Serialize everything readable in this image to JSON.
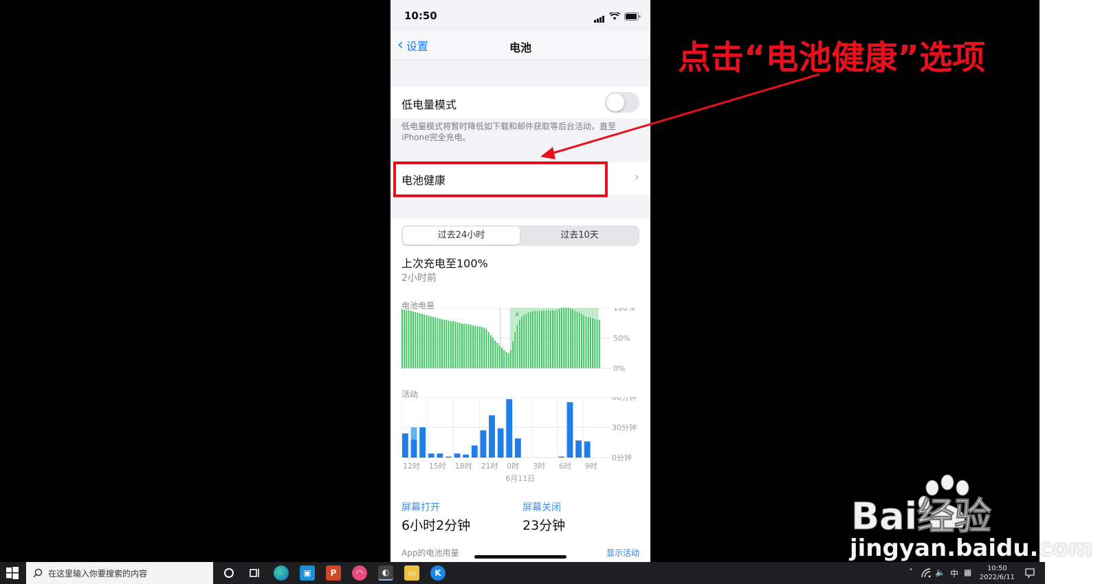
{
  "status_bar": {
    "time": "10:50"
  },
  "nav": {
    "back_label": "设置",
    "title": "电池"
  },
  "low_power": {
    "label": "低电量模式",
    "enabled": false,
    "footnote": "低电量模式将暂时降低如下载和邮件获取等后台活动，直至iPhone完全充电。"
  },
  "battery_health": {
    "label": "电池健康"
  },
  "segment": {
    "options": [
      "过去24小时",
      "过去10天"
    ],
    "selected": 0
  },
  "last_charge": {
    "title": "上次充电至100%",
    "subtitle": "2小时前"
  },
  "battery_chart": {
    "label": "电池电量",
    "y_ticks": [
      "100%",
      "50%",
      "0%"
    ]
  },
  "activity_chart": {
    "label": "活动",
    "y_ticks": [
      "60分钟",
      "30分钟",
      "0分钟"
    ],
    "x_ticks": [
      "12时",
      "15时",
      "18时",
      "21时",
      "0时",
      "3时",
      "6时",
      "9时"
    ],
    "date_label": "6月11日"
  },
  "chart_data": [
    {
      "type": "bar",
      "title": "电池电量",
      "ylim": [
        0,
        100
      ],
      "y_ticks": [
        "0%",
        "50%",
        "100%"
      ],
      "values": [
        98,
        97,
        96,
        96,
        95,
        94,
        93,
        92,
        91,
        90,
        89,
        88,
        87,
        86,
        85,
        84,
        83,
        82,
        81,
        80,
        80,
        79,
        78,
        78,
        77,
        76,
        75,
        74,
        74,
        73,
        73,
        72,
        71,
        70,
        70,
        69,
        68,
        67,
        65,
        60,
        55,
        50,
        46,
        42,
        38,
        34,
        30,
        27,
        25,
        30,
        45,
        60,
        72,
        80,
        85,
        88,
        90,
        92,
        93,
        94,
        95,
        95,
        95,
        95,
        96,
        96,
        96,
        96,
        96,
        96,
        96,
        98,
        100,
        100,
        100,
        100,
        99,
        98,
        96,
        94,
        92,
        90,
        88,
        86,
        85,
        84,
        83,
        82,
        81,
        80
      ],
      "charging_range": [
        49,
        88
      ]
    },
    {
      "type": "bar",
      "title": "活动",
      "ylim": [
        0,
        60
      ],
      "y_ticks": [
        "0分钟",
        "30分钟",
        "60分钟"
      ],
      "categories": [
        "12时",
        "",
        "",
        "15时",
        "",
        "",
        "18时",
        "",
        "",
        "21时",
        "",
        "",
        "0时",
        "",
        "",
        "3时",
        "",
        "",
        "6时",
        "",
        "",
        "9时",
        ""
      ],
      "series": [
        {
          "values": [
            24,
            18,
            30,
            4,
            4,
            1,
            4,
            3,
            12,
            27,
            42,
            29,
            58,
            19,
            0,
            0,
            0,
            0,
            1,
            55,
            17,
            16,
            0
          ]
        },
        {
          "values": [
            0,
            12,
            0,
            0,
            0,
            0,
            0,
            0,
            0,
            0,
            0,
            0,
            0,
            0,
            0,
            0,
            0,
            0,
            0,
            0,
            0,
            0,
            0
          ]
        }
      ],
      "colors": [
        "#1f7ee8",
        "#66b3f2"
      ]
    }
  ],
  "screen_on": {
    "label": "屏幕打开",
    "value": "6小时2分钟"
  },
  "screen_off": {
    "label": "屏幕关闭",
    "value": "23分钟"
  },
  "app_usage": {
    "label": "App的电池用量",
    "action": "显示活动"
  },
  "annotation": {
    "text": "点击“电池健康”选项",
    "color": "#e8101c"
  },
  "watermark": {
    "logo_text": "Bai经验",
    "url": "jingyan.baidu.com"
  },
  "taskbar": {
    "search_placeholder": "在这里输入你要搜索的内容",
    "ime": "中",
    "time": "10:50",
    "date": "2022/6/11"
  },
  "colors": {
    "accent": "#1a7cf0",
    "battery_green": "#34c759",
    "activity_blue": "#1f7ee8"
  }
}
